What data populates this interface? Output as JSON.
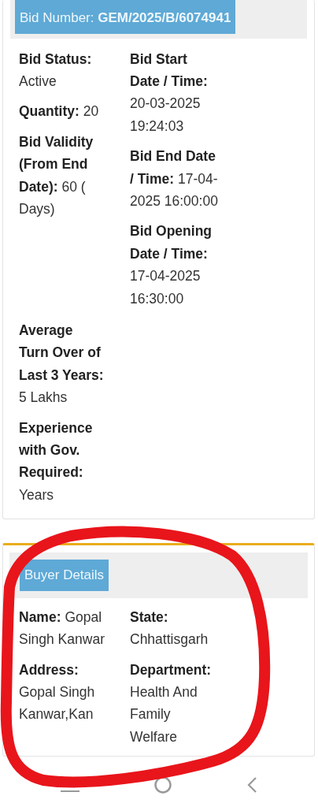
{
  "bid_header": {
    "label": "Bid Number:",
    "value": "GEM/2025/B/6074941"
  },
  "bid_details": {
    "left": [
      {
        "label": "Bid Status:",
        "value": "Active"
      },
      {
        "label": "Quantity:",
        "value": "20"
      },
      {
        "label": "Bid Validity (From End Date):",
        "value": "60 ( Days)"
      }
    ],
    "right": [
      {
        "label": "Bid Start Date / Time:",
        "value": "20-03-2025 19:24:03"
      },
      {
        "label": "Bid End Date / Time:",
        "value": "17-04-2025 16:00:00"
      },
      {
        "label": "Bid Opening Date / Time:",
        "value": "17-04-2025 16:30:00"
      }
    ],
    "bottom": [
      {
        "label": "Average Turn Over of Last 3 Years:",
        "value": "5 Lakhs"
      },
      {
        "label": "Experience with Gov. Required:",
        "value": "Years"
      }
    ]
  },
  "buyer_details": {
    "title": "Buyer Details",
    "left": [
      {
        "label": "Name:",
        "value": "Gopal Singh Kanwar"
      },
      {
        "label": "Address:",
        "value": "Gopal Singh Kanwar,Kan"
      }
    ],
    "right": [
      {
        "label": "State:",
        "value": "Chhattisgarh"
      },
      {
        "label": "Department:",
        "value": "Health And Family Welfare"
      }
    ]
  }
}
